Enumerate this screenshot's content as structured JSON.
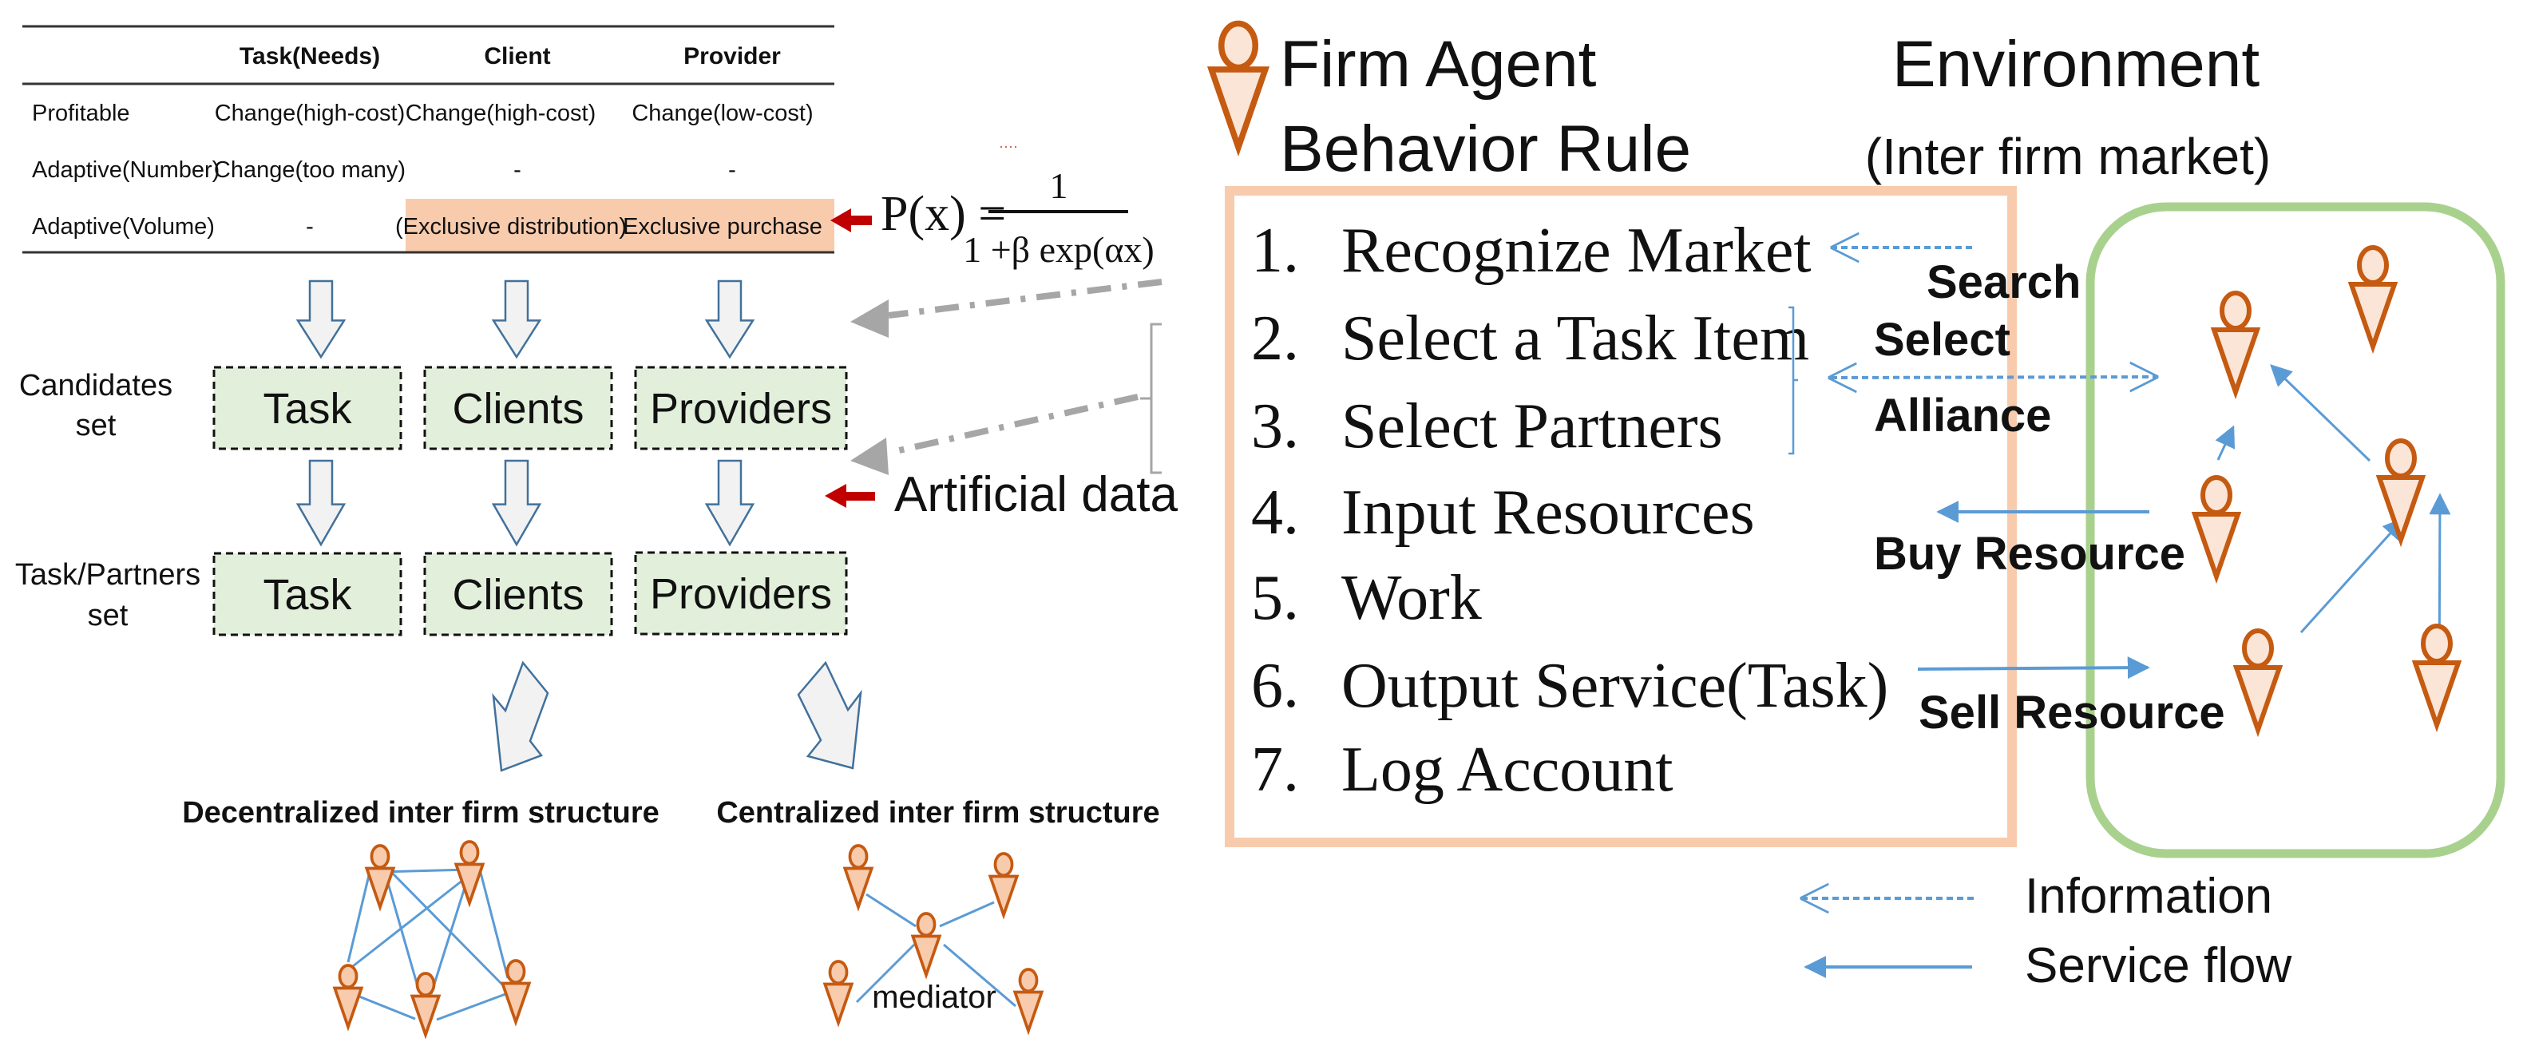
{
  "table": {
    "headers": [
      "",
      "Task(Needs)",
      "Client",
      "Provider"
    ],
    "rows": [
      [
        "Profitable",
        "Change(high-cost)",
        "Change(high-cost)",
        "Change(low-cost)"
      ],
      [
        "Adaptive(Number)",
        "Change(too many)",
        "-",
        "-"
      ],
      [
        "Adaptive(Volume)",
        "-",
        "(Exclusive distribution)",
        "Exclusive purchase"
      ]
    ],
    "highlight_color": "#f8cbad"
  },
  "formula": {
    "lhs": "P(x) =",
    "numerator": "1",
    "denominator": "1 +β exp(αx)"
  },
  "sets": {
    "candidates_label_line1": "Candidates",
    "candidates_label_line2": "set",
    "partners_label_line1": "Task/Partners",
    "partners_label_line2": "set",
    "boxes": [
      "Task",
      "Clients",
      "Providers"
    ],
    "box_fill": "#e2efda"
  },
  "artificial_data_label": "Artificial data",
  "structures": {
    "decentralized_title": "Decentralized inter firm structure",
    "centralized_title": "Centralized inter firm structure",
    "mediator_label": "mediator"
  },
  "behavior": {
    "title_line1": "Firm Agent",
    "title_line2": "Behavior Rule",
    "rules": [
      {
        "num": "1.",
        "text": "Recognize Market"
      },
      {
        "num": "2.",
        "text": "Select a Task Item"
      },
      {
        "num": "3.",
        "text": "Select Partners"
      },
      {
        "num": "4.",
        "text": "Input Resources"
      },
      {
        "num": "5.",
        "text": "Work"
      },
      {
        "num": "6.",
        "text": "Output Service(Task)"
      },
      {
        "num": "7.",
        "text": "Log Account"
      }
    ],
    "box_color": "#f8cbad"
  },
  "environment": {
    "title": "Environment",
    "subtitle": "(Inter firm market)",
    "box_color": "#a9d18e"
  },
  "actions": {
    "search": "Search",
    "select_line1": "Select",
    "select_line2": "Alliance",
    "buy": "Buy Resource",
    "sell": "Sell Resource"
  },
  "legend": {
    "information": "Information",
    "service_flow": "Service flow"
  },
  "colors": {
    "agent_stroke": "#c55a11",
    "agent_fill": "#fbe5d6",
    "agent_fill_dark": "#f8cbad",
    "link_blue": "#5b9bd5",
    "arrow_outline": "#41719c",
    "arrow_fill": "#f2f2f2",
    "red_arrow": "#c00000",
    "grey_arrow": "#a6a6a6"
  }
}
